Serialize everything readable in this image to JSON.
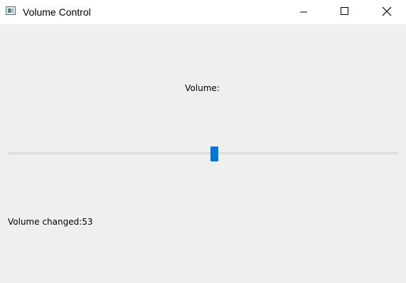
{
  "window": {
    "title": "Volume Control",
    "controls": {
      "minimize": "minimize-icon",
      "maximize": "maximize-icon",
      "close": "close-icon"
    }
  },
  "main": {
    "volume_label": "Volume:",
    "slider": {
      "min": 0,
      "max": 100,
      "value": 53,
      "accent_color": "#0078d7"
    },
    "status_text": "Volume changed:53"
  }
}
